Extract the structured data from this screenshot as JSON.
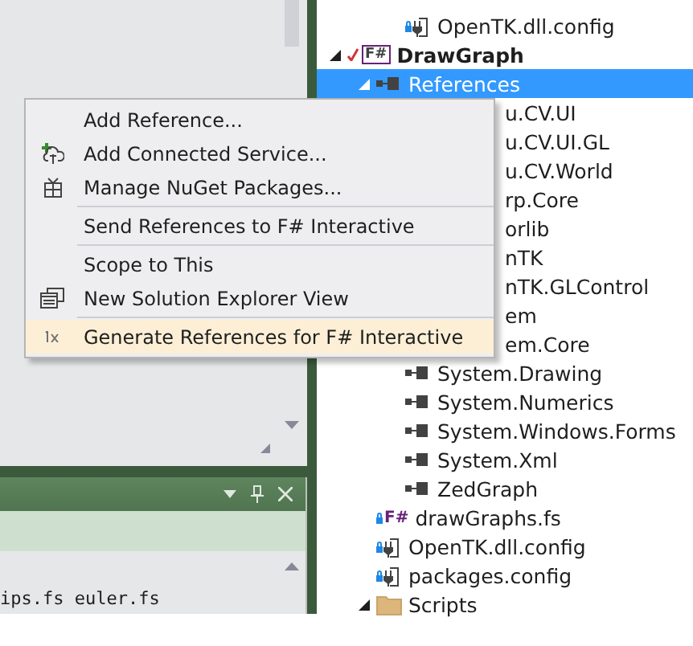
{
  "menu": {
    "items": [
      {
        "kind": "plain",
        "label": "Add Reference...",
        "highlighted": false
      },
      {
        "kind": "service",
        "label": "Add Connected Service...",
        "highlighted": false
      },
      {
        "kind": "packages",
        "label": "Manage NuGet Packages...",
        "highlighted": false
      },
      {
        "kind": "separator"
      },
      {
        "kind": "plain",
        "label": "Send References to F# Interactive",
        "highlighted": false
      },
      {
        "kind": "separator"
      },
      {
        "kind": "plain",
        "label": "Scope to This",
        "highlighted": false
      },
      {
        "kind": "view",
        "label": "New Solution Explorer View",
        "highlighted": false
      },
      {
        "kind": "separator"
      },
      {
        "kind": "generate",
        "label": "Generate References for F# Interactive",
        "highlighted": true
      }
    ]
  },
  "tool_window": {
    "lines": [
      "ips.fs euler.fs"
    ]
  },
  "solution_explorer": {
    "preceding_items": [
      {
        "kind": "config",
        "label": "OpenTK.dll.config"
      }
    ],
    "items": [
      {
        "kind": "project",
        "label": "DrawGraph",
        "badge": "F#",
        "expanded": true,
        "selected": false,
        "children": [
          {
            "kind": "references",
            "label": "References",
            "expanded": true,
            "selected": true,
            "children": [
              {
                "kind": "partial",
                "label": "u.CV.UI"
              },
              {
                "kind": "partial",
                "label": "u.CV.UI.GL"
              },
              {
                "kind": "partial",
                "label": "u.CV.World"
              },
              {
                "kind": "partial",
                "label": "rp.Core"
              },
              {
                "kind": "partial",
                "label": "orlib"
              },
              {
                "kind": "partial",
                "label": "nTK"
              },
              {
                "kind": "partial",
                "label": "nTK.GLControl"
              },
              {
                "kind": "partial",
                "label": "em"
              },
              {
                "kind": "partial",
                "label": "em.Core"
              },
              {
                "kind": "reference",
                "label": "System.Drawing"
              },
              {
                "kind": "reference",
                "label": "System.Numerics"
              },
              {
                "kind": "reference",
                "label": "System.Windows.Forms"
              },
              {
                "kind": "reference",
                "label": "System.Xml"
              },
              {
                "kind": "reference",
                "label": "ZedGraph"
              }
            ]
          },
          {
            "kind": "fsharp",
            "label": "drawGraphs.fs",
            "badge": "F#",
            "selected": false
          },
          {
            "kind": "config",
            "label": "OpenTK.dll.config",
            "selected": false
          },
          {
            "kind": "config",
            "label": "packages.config",
            "selected": false
          },
          {
            "kind": "folder",
            "label": "Scripts",
            "expanded": true,
            "selected": false
          }
        ]
      }
    ]
  }
}
